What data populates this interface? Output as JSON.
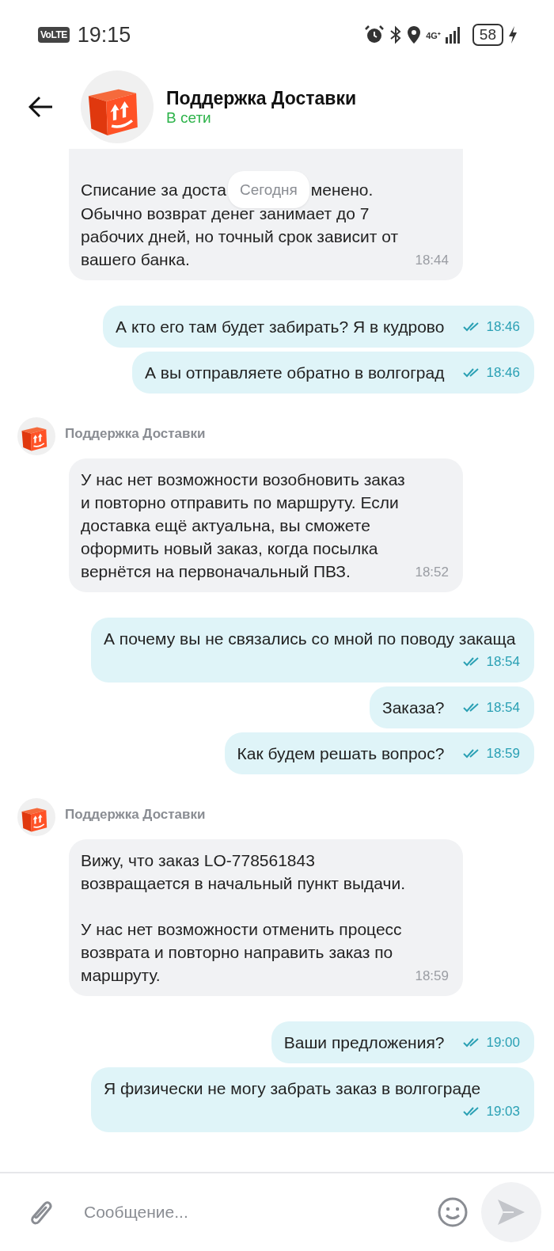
{
  "status_bar": {
    "network_badge": "VoLTE",
    "time": "19:15",
    "network_type": "4G⁺",
    "battery": "58"
  },
  "header": {
    "title": "Поддержка Доставки",
    "status": "В сети"
  },
  "date_divider": "Сегодня",
  "first_message": {
    "line_start": "Списание за доста",
    "line_end": "менено.",
    "text": "Обычно возврат денег занимает до 7 рабочих дней, но точный срок зависит от вашего банка.",
    "time": "18:44"
  },
  "messages": [
    {
      "kind": "outgoing",
      "text": "А кто его там будет забирать? Я в кудрово",
      "time": "18:46",
      "read": true
    },
    {
      "kind": "outgoing",
      "text": "А вы отправляете обратно в волгоград",
      "time": "18:46",
      "read": true
    },
    {
      "kind": "sender",
      "name": "Поддержка Доставки"
    },
    {
      "kind": "incoming",
      "paragraphs": [
        "У нас нет возможности возобновить заказ и повторно отправить по маршруту. Если доставка ещё актуальна, вы сможете оформить новый заказ, когда посылка вернётся на первоначальный ПВЗ."
      ],
      "time": "18:52"
    },
    {
      "kind": "outgoing",
      "text": "А почему вы не связались со мной по поводу закаща",
      "time": "18:54",
      "read": true
    },
    {
      "kind": "outgoing",
      "text": "Заказа?",
      "time": "18:54",
      "read": true
    },
    {
      "kind": "outgoing",
      "text": "Как будем решать вопрос?",
      "time": "18:59",
      "read": true
    },
    {
      "kind": "sender",
      "name": "Поддержка Доставки"
    },
    {
      "kind": "incoming",
      "paragraphs": [
        "Вижу, что заказ LO-778561843 возвращается в начальный пункт выдачи.",
        "У нас нет возможности отменить процесс возврата и повторно направить заказ по маршруту."
      ],
      "time": "18:59"
    },
    {
      "kind": "outgoing",
      "text": "Ваши предложения?",
      "time": "19:00",
      "read": true
    },
    {
      "kind": "outgoing",
      "text": "Я физически не могу забрать заказ в волгограде",
      "time": "19:03",
      "read": true
    }
  ],
  "composer": {
    "placeholder": "Сообщение..."
  }
}
